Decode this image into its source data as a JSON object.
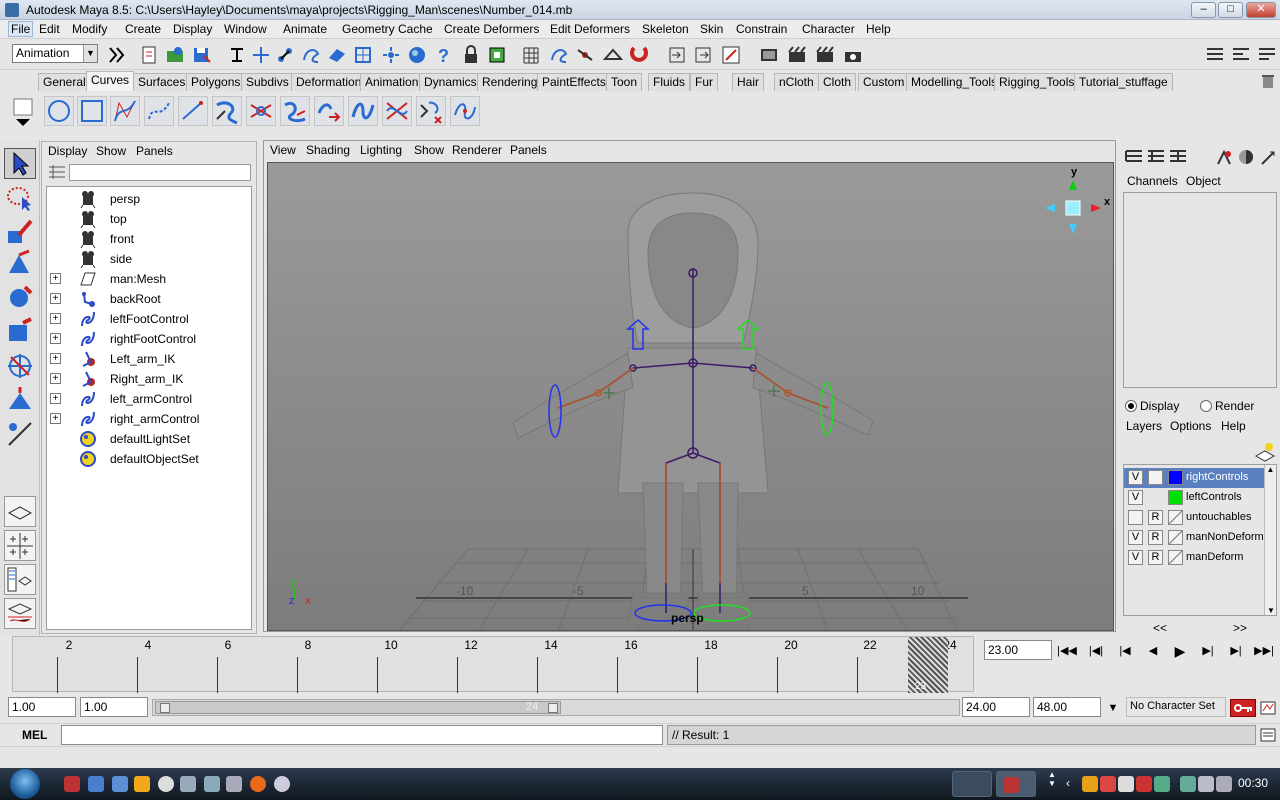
{
  "window": {
    "title": "Autodesk Maya 8.5: C:\\Users\\Hayley\\Documents\\maya\\projects\\Rigging_Man\\scenes\\Number_014.mb",
    "min": "–",
    "max": "□",
    "close": "✕"
  },
  "menubar": [
    "File",
    "Edit",
    "Modify",
    "Create",
    "Display",
    "Window",
    "Animate",
    "Geometry Cache",
    "Create Deformers",
    "Edit Deformers",
    "Skeleton",
    "Skin",
    "Constrain",
    "Character",
    "Help"
  ],
  "statusline": {
    "mode": "Animation"
  },
  "shelf_tabs": [
    "General",
    "Curves",
    "Surfaces",
    "Polygons",
    "Subdivs",
    "Deformation",
    "Animation",
    "Dynamics",
    "Rendering",
    "PaintEffects",
    "Toon",
    "Fluids",
    "Fur",
    "Hair",
    "nCloth",
    "Cloth",
    "Custom",
    "Modelling_Tools",
    "Rigging_Tools",
    "Tutorial_stuffage"
  ],
  "shelf_active": "Curves",
  "outliner": {
    "menus": [
      "Display",
      "Show",
      "Panels"
    ],
    "items": [
      {
        "label": "persp",
        "icon": "camera-icon",
        "expandable": false
      },
      {
        "label": "top",
        "icon": "camera-icon",
        "expandable": false
      },
      {
        "label": "front",
        "icon": "camera-icon",
        "expandable": false
      },
      {
        "label": "side",
        "icon": "camera-icon",
        "expandable": false
      },
      {
        "label": "man:Mesh",
        "icon": "mesh-icon",
        "expandable": true
      },
      {
        "label": "backRoot",
        "icon": "joint-icon",
        "expandable": true
      },
      {
        "label": "leftFootControl",
        "icon": "curve-icon",
        "expandable": true
      },
      {
        "label": "rightFootControl",
        "icon": "curve-icon",
        "expandable": true
      },
      {
        "label": "Left_arm_IK",
        "icon": "ik-handle-icon",
        "expandable": true
      },
      {
        "label": "Right_arm_IK",
        "icon": "ik-handle-icon",
        "expandable": true
      },
      {
        "label": "left_armControl",
        "icon": "curve-icon",
        "expandable": true
      },
      {
        "label": "right_armControl",
        "icon": "curve-icon",
        "expandable": true
      },
      {
        "label": "defaultLightSet",
        "icon": "set-icon",
        "expandable": false
      },
      {
        "label": "defaultObjectSet",
        "icon": "set-icon",
        "expandable": false
      }
    ]
  },
  "viewport": {
    "menus": [
      "View",
      "Shading",
      "Lighting",
      "Show",
      "Renderer",
      "Panels"
    ],
    "camera_label": "persp",
    "grid_labels": [
      "-10",
      "-5",
      "5",
      "10"
    ],
    "axis": {
      "y": "y",
      "x": "x",
      "z": "z"
    }
  },
  "channelbox": {
    "tabs": [
      "Channels",
      "Object"
    ],
    "display_radio": "Display",
    "render_radio": "Render",
    "layer_menus": [
      "Layers",
      "Options",
      "Help"
    ],
    "layers": [
      {
        "v": "V",
        "r": "",
        "color": "#0000ff",
        "name": "rightControls",
        "selected": true
      },
      {
        "v": "V",
        "r": "",
        "color": "#00e000",
        "name": "leftControls",
        "selected": false
      },
      {
        "v": "",
        "r": "R",
        "color": "",
        "name": "untouchables",
        "selected": false
      },
      {
        "v": "V",
        "r": "R",
        "color": "",
        "name": "manNonDeform",
        "selected": false
      },
      {
        "v": "V",
        "r": "R",
        "color": "",
        "name": "manDeform",
        "selected": false
      }
    ],
    "scroll_left": "<<",
    "scroll_right": ">>"
  },
  "timeslider": {
    "ticks": [
      "2",
      "4",
      "6",
      "8",
      "10",
      "12",
      "14",
      "16",
      "18",
      "20",
      "22",
      "24"
    ],
    "current_time": "23.00",
    "current_frame_marker": "23"
  },
  "range": {
    "start": "1.00",
    "playback_start": "1.00",
    "playback_end": "24.00",
    "end": "48.00",
    "slider_end_label": "24",
    "character_set": "No Character Set"
  },
  "command": {
    "lang": "MEL",
    "result": "// Result: 1"
  },
  "taskbar": {
    "clock": "00:30"
  }
}
